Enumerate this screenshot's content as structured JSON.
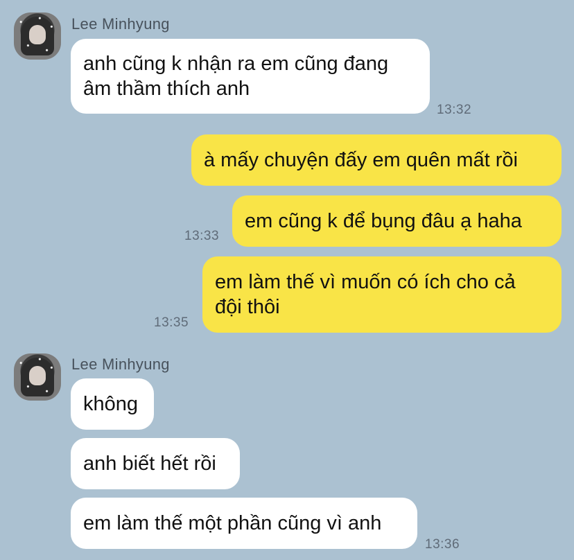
{
  "colors": {
    "background": "#abc1d1",
    "incoming_bubble": "#ffffff",
    "outgoing_bubble": "#f9e447",
    "sender_name": "#48525c",
    "timestamp": "#5f6b78"
  },
  "groups": [
    {
      "sender": "Lee Minhyung",
      "avatar_icon": "profile-photo-icon",
      "messages": [
        {
          "text": "anh cũng k nhận ra em cũng đang\nâm thầm thích anh",
          "time": "13:32"
        }
      ]
    },
    {
      "sender": "me",
      "messages": [
        {
          "text": "à mấy chuyện đấy em quên mất rồi",
          "time": ""
        },
        {
          "text": "em cũng k để bụng đâu ạ haha",
          "time": "13:33"
        },
        {
          "text": "em làm thế vì muốn có ích cho cả\nđội thôi",
          "time": "13:35"
        }
      ]
    },
    {
      "sender": "Lee Minhyung",
      "avatar_icon": "profile-photo-icon",
      "messages": [
        {
          "text": "không",
          "time": ""
        },
        {
          "text": "anh biết hết rồi",
          "time": ""
        },
        {
          "text": "em làm thế một phần cũng vì anh",
          "time": "13:36"
        }
      ]
    }
  ]
}
